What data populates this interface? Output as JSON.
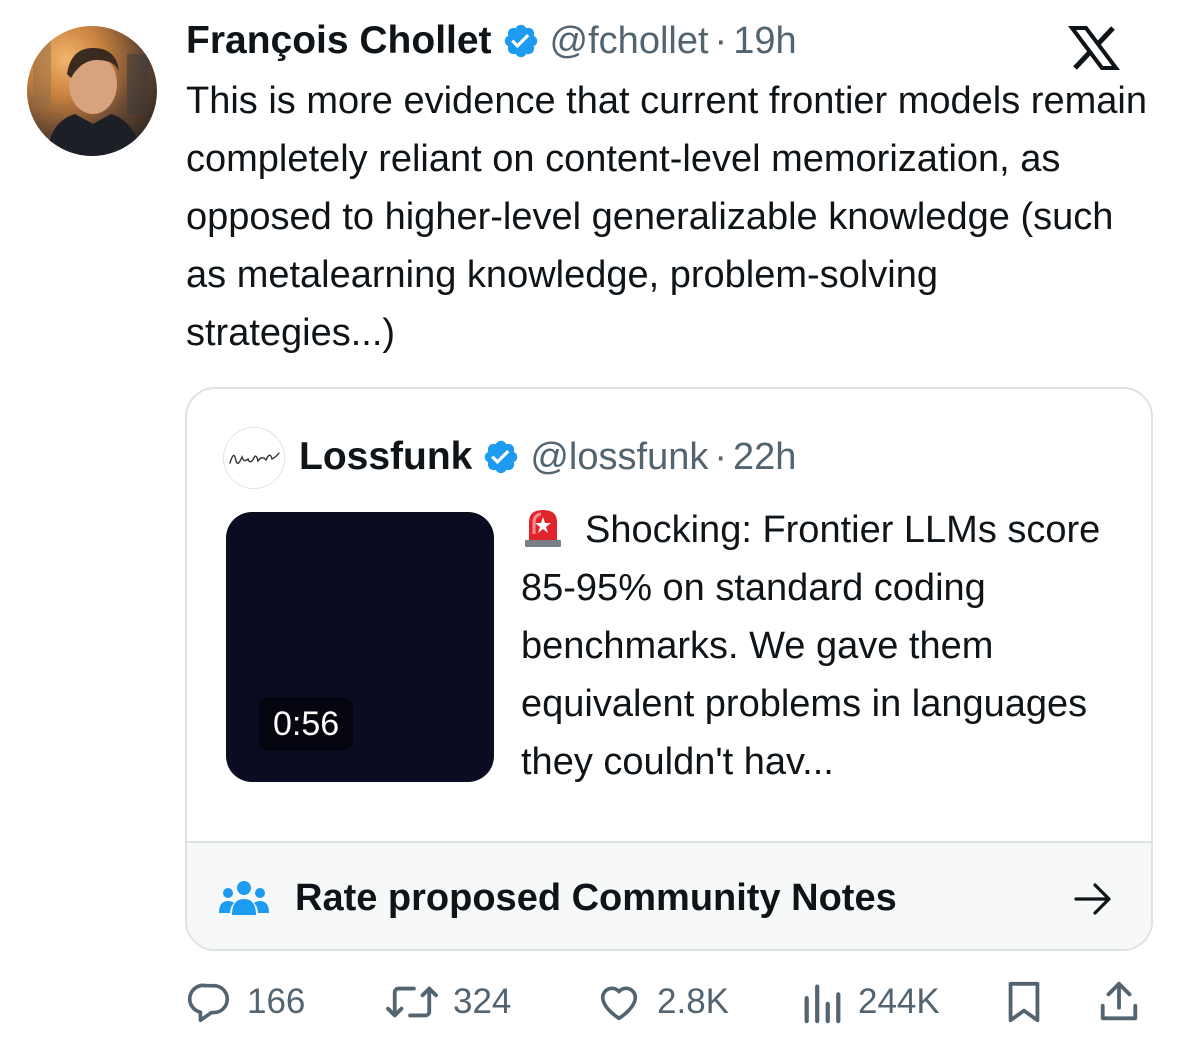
{
  "tweet": {
    "author_name": "François Chollet",
    "handle": "@fchollet",
    "separator": "·",
    "time": "19h",
    "text": "This is more evidence that current frontier models remain completely reliant on content-level memorization, as opposed to higher-level generalizable knowledge (such as metalearning knowledge, problem-solving strategies...)",
    "verified": true
  },
  "quoted_tweet": {
    "author_name": "Lossfunk",
    "handle": "@lossfunk",
    "separator": "·",
    "time": "22h",
    "verified": true,
    "video_duration": "0:56",
    "text": "Shocking: Frontier LLMs score 85-95% on standard coding benchmarks. We gave them equivalent problems in languages they couldn't hav...",
    "emoji": "siren-icon"
  },
  "community_notes": {
    "label": "Rate proposed Community Notes"
  },
  "actions": {
    "replies": "166",
    "retweets": "324",
    "likes": "2.8K",
    "views": "244K"
  },
  "colors": {
    "verified_blue": "#1d9bf0",
    "secondary_text": "#536471",
    "primary_text": "#0f1419",
    "notes_icon": "#1d9bf0"
  },
  "icons": [
    "x-logo-icon",
    "verified-badge-icon",
    "reply-icon",
    "retweet-icon",
    "like-icon",
    "views-icon",
    "bookmark-icon",
    "share-icon",
    "community-notes-icon",
    "arrow-right-icon",
    "siren-icon"
  ]
}
